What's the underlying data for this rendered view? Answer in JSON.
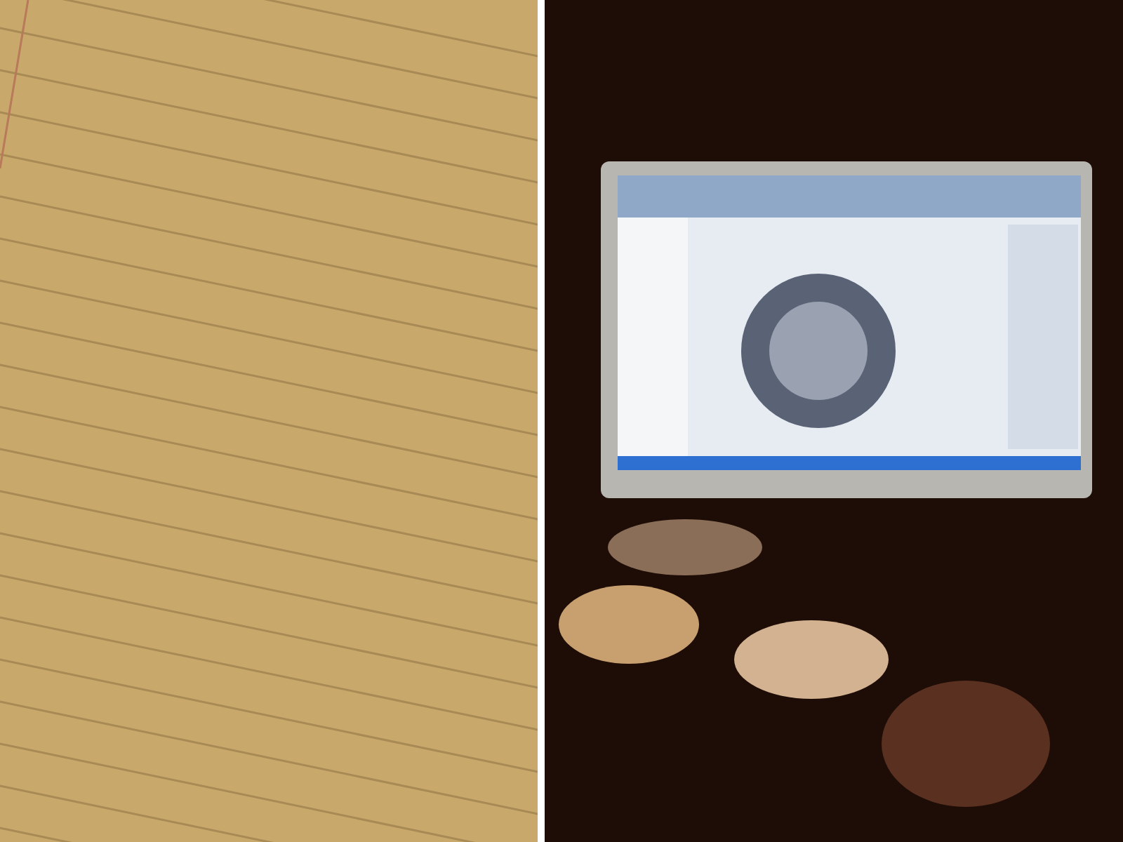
{
  "panels": [
    {
      "kind": "paper"
    },
    {
      "kind": "desk"
    }
  ]
}
